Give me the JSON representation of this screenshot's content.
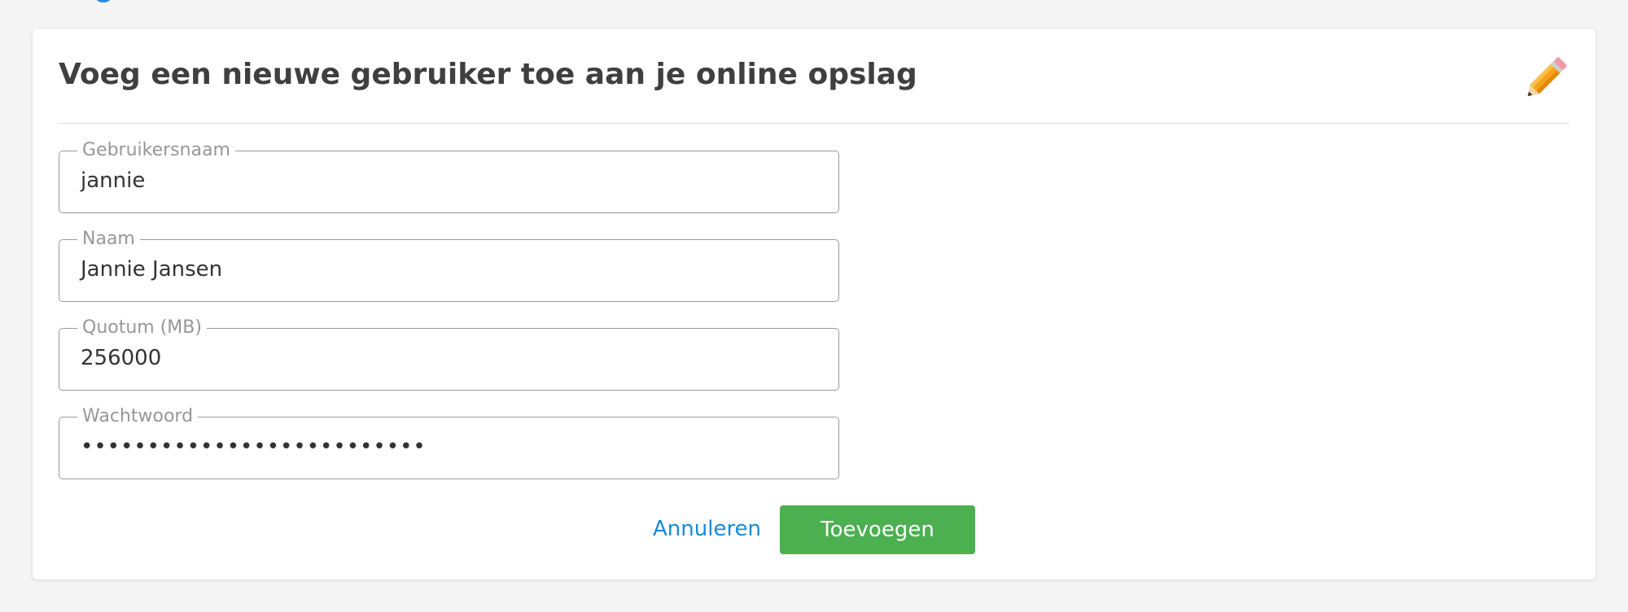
{
  "dialog": {
    "title": "Voeg een nieuwe gebruiker toe aan je online opslag",
    "edit_icon": "pencil-icon"
  },
  "fields": [
    {
      "label": "Gebruikersnaam",
      "value": "jannie"
    },
    {
      "label": "Naam",
      "value": "Jannie Jansen"
    },
    {
      "label": "Quotum (MB)",
      "value": "256000"
    },
    {
      "label": "Wachtwoord",
      "value": "••••••••••••••••••••••••••"
    }
  ],
  "actions": {
    "cancel_label": "Annuleren",
    "add_label": "Toevoegen"
  },
  "colors": {
    "accent_link": "#1a8ad8",
    "primary_button": "#4caf50",
    "pencil_body": "#f7a11a"
  }
}
